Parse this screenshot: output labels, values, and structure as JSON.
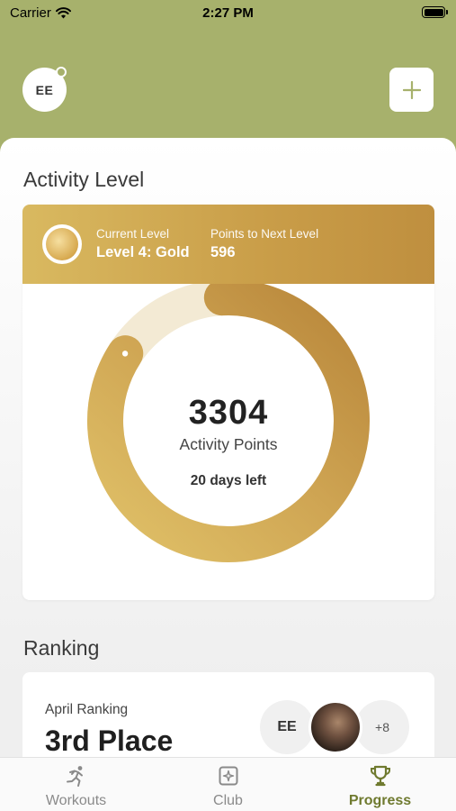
{
  "status_bar": {
    "carrier": "Carrier",
    "time": "2:27 PM"
  },
  "header": {
    "avatar_initials": "EE"
  },
  "activity": {
    "title": "Activity Level",
    "current_level_label": "Current Level",
    "current_level_value": "Level 4: Gold",
    "points_next_label": "Points to Next Level",
    "points_next_value": "596",
    "points": "3304",
    "points_label": "Activity Points",
    "days_left": "20 days left",
    "progress_fraction": 0.85
  },
  "ranking": {
    "title": "Ranking",
    "subtitle": "April Ranking",
    "place": "3rd Place",
    "avatar_initials": "EE",
    "more_count": "+8"
  },
  "tabs": [
    {
      "label": "Workouts",
      "icon": "runner-icon",
      "active": false
    },
    {
      "label": "Club",
      "icon": "club-icon",
      "active": false
    },
    {
      "label": "Progress",
      "icon": "trophy-icon",
      "active": true
    }
  ],
  "colors": {
    "header_green": "#a7b16c",
    "gold": "#c99d48",
    "active_tab": "#6f7a2f"
  }
}
